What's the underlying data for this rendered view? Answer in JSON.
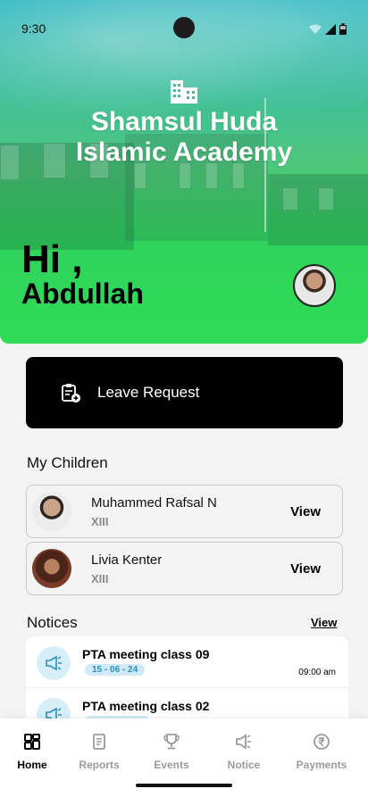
{
  "status_bar": {
    "time": "9:30"
  },
  "header": {
    "school_name_line1": "Shamsul Huda",
    "school_name_line2": "Islamic Academy",
    "greeting": "Hi ,",
    "user_name": "Abdullah",
    "school_icon": "building-icon",
    "theme_color": "#2fdb57"
  },
  "leave_request": {
    "label": "Leave Request",
    "icon": "clipboard-add-icon"
  },
  "children": {
    "title": "My Children",
    "items": [
      {
        "name": "Muhammed Rafsal N",
        "class": "XIII",
        "action": "View"
      },
      {
        "name": "Livia Kenter",
        "class": "XIII",
        "action": "View"
      }
    ]
  },
  "notices": {
    "title": "Notices",
    "view_label": "View",
    "items": [
      {
        "title": "PTA meeting class 09",
        "date": "15 - 06 - 24",
        "time": "09:00 am",
        "icon": "megaphone-icon"
      },
      {
        "title": "PTA meeting class 02",
        "date": "",
        "time": "",
        "icon": "megaphone-icon"
      }
    ]
  },
  "bottom_nav": {
    "items": [
      {
        "label": "Home",
        "icon": "grid-icon",
        "active": true
      },
      {
        "label": "Reports",
        "icon": "document-icon",
        "active": false
      },
      {
        "label": "Events",
        "icon": "trophy-icon",
        "active": false
      },
      {
        "label": "Notice",
        "icon": "megaphone-icon",
        "active": false
      },
      {
        "label": "Payments",
        "icon": "rupee-icon",
        "active": false
      }
    ]
  }
}
